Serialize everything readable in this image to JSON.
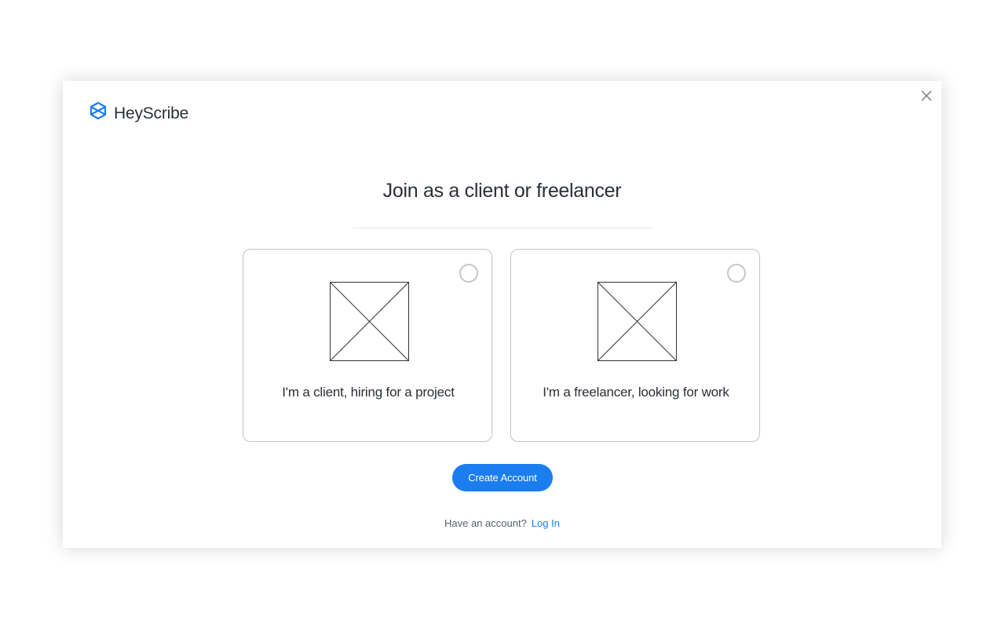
{
  "brand": {
    "name": "HeyScribe",
    "icon": "heyscribe-logo-icon",
    "color": "#1a7df0"
  },
  "dialog": {
    "title": "Join as a client or freelancer",
    "close_icon": "close-icon"
  },
  "options": [
    {
      "id": "client",
      "label": "I'm a client, hiring for a project",
      "selected": false,
      "image": "image-placeholder-icon"
    },
    {
      "id": "freelancer",
      "label": "I'm a freelancer, looking for work",
      "selected": false,
      "image": "image-placeholder-icon"
    }
  ],
  "actions": {
    "create_account_label": "Create Account",
    "button_color": "#1a7df0"
  },
  "footer": {
    "prompt": "Have an account?",
    "login_label": "Log In",
    "link_color": "#1a7df0"
  }
}
